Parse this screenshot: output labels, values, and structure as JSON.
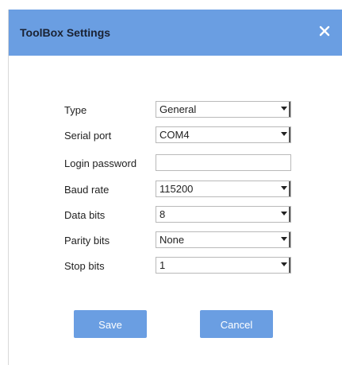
{
  "dialog": {
    "title": "ToolBox Settings",
    "close_icon": "close-icon",
    "accent_color": "#6a9ee2"
  },
  "form": {
    "type": {
      "label": "Type",
      "value": "General"
    },
    "serial_port": {
      "label": "Serial port",
      "value": "COM4"
    },
    "login_password": {
      "label": "Login password",
      "value": ""
    },
    "baud_rate": {
      "label": "Baud rate",
      "value": "115200"
    },
    "data_bits": {
      "label": "Data bits",
      "value": "8"
    },
    "parity_bits": {
      "label": "Parity bits",
      "value": "None"
    },
    "stop_bits": {
      "label": "Stop bits",
      "value": "1"
    }
  },
  "buttons": {
    "save": "Save",
    "cancel": "Cancel"
  }
}
